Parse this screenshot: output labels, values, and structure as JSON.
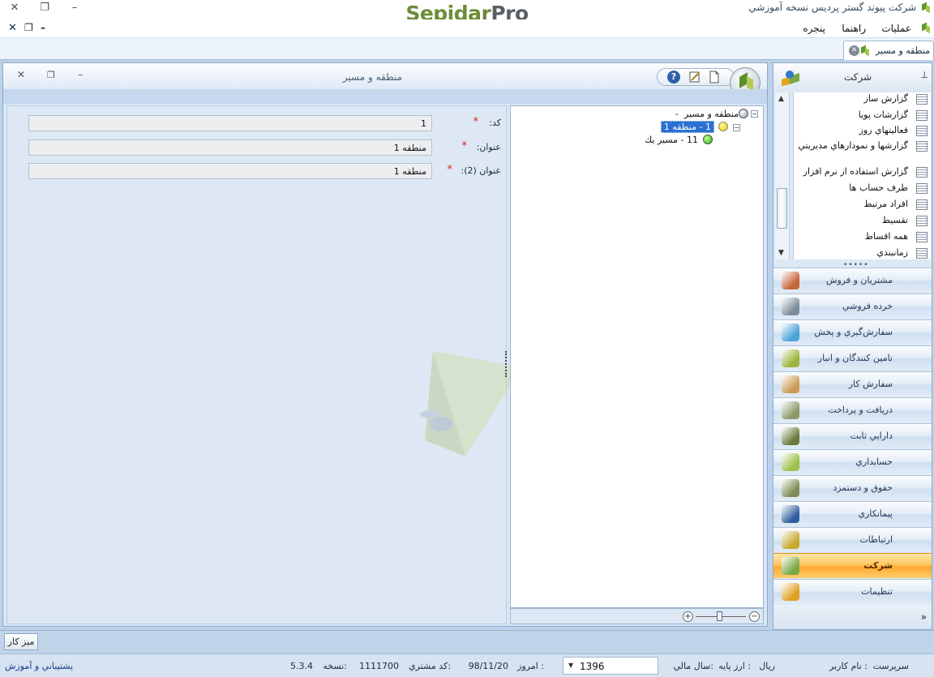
{
  "app": {
    "title": "شركت پيوند گستر پرديس نسخه آموزشي",
    "logo_main": "Sepidar",
    "logo_pro": "Pro",
    "window_controls": [
      "–",
      "❐",
      "✕"
    ],
    "mdi_controls": [
      "–",
      "❐",
      "✕"
    ]
  },
  "menu": {
    "items": [
      "عمليات",
      "راهنما",
      "پنجره"
    ]
  },
  "tabs": [
    {
      "label": "منطقه و مسير"
    }
  ],
  "form": {
    "title": "منطقه و مسير",
    "window_controls": [
      "–",
      "❐",
      "✕"
    ],
    "toolbar_help": "?",
    "fields": [
      {
        "label": "كد:",
        "value": "1"
      },
      {
        "label": "عنوان:",
        "value": "منطقه 1"
      },
      {
        "label": "عنوان (2):",
        "value": "منطقه 1"
      }
    ],
    "required_mark": "*"
  },
  "tree": {
    "nodes": [
      {
        "label": "منطقه و مسير",
        "code": "-",
        "level": 0
      },
      {
        "label": "1  -  منطقه 1",
        "level": 1,
        "selected": true
      },
      {
        "label": "11  -  مسير يك",
        "level": 2
      }
    ],
    "zoom_minus": "−",
    "zoom_plus": "+"
  },
  "sidebar": {
    "title": "شركت",
    "pin": "⊥",
    "sub_items": [
      "گزارش ساز",
      "گزارشات پويا",
      "فعاليتهاي روز",
      "گزارشها و نمودارهاي مديريتي",
      "گزارش استفاده از نرم افزار",
      "طرف حساب ها",
      "افراد مرتبط",
      "تقسيط",
      "همه اقساط",
      "زمانبندي"
    ],
    "modules": [
      {
        "label": "مشتريان و فروش",
        "color": "#c8653a"
      },
      {
        "label": "خرده فروشي",
        "color": "#7d8c9a"
      },
      {
        "label": "سفارش‌گيري و پخش",
        "color": "#4aa3d8"
      },
      {
        "label": "تامين كنندگان و انبار",
        "color": "#9bb43a"
      },
      {
        "label": "سفارش كار",
        "color": "#c99a55"
      },
      {
        "label": "دريافت و پرداخت",
        "color": "#8a9a6a"
      },
      {
        "label": "دارايي ثابت",
        "color": "#6b7a3a"
      },
      {
        "label": "حسابداري",
        "color": "#9cc04a"
      },
      {
        "label": "حقوق و دستمزد",
        "color": "#7e8b56"
      },
      {
        "label": "پيمانكاري",
        "color": "#2f5f9e"
      },
      {
        "label": "ارتباطات",
        "color": "#c8a830"
      },
      {
        "label": "شركت",
        "color": "#7aa845",
        "active": true
      },
      {
        "label": "تنظيمات",
        "color": "#e0a020"
      }
    ],
    "footer_chevron": "»"
  },
  "taskbar": {
    "desk_button": "ميز كار"
  },
  "status": {
    "user_label": "نام كاربر :",
    "user": "سرپرست",
    "currency_label": "ارز پايه :",
    "currency": "ريال",
    "fiscal_year_label": "سال مالي:",
    "fiscal_year": "1396",
    "today_label": "امروز :",
    "today": "98/11/20",
    "customer_code_label": "كد مشتري:",
    "customer_code": "1111700",
    "version_label": "نسخه:",
    "version": "5.3.4",
    "support_link": "پشتيباني و آموزش"
  }
}
